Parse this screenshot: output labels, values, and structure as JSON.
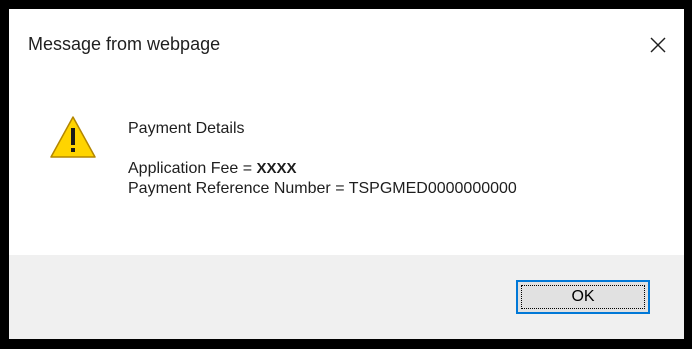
{
  "dialog": {
    "title": "Message from webpage",
    "close_icon": "close-icon",
    "warning_icon": "warning-icon",
    "message": {
      "heading": "Payment Details",
      "fee_label": "Application Fee = ",
      "fee_value": "XXXX",
      "reference_line": "Payment Reference Number = TSPGMED0000000000"
    },
    "ok_label": "OK"
  },
  "colors": {
    "frame": "#000000",
    "footer_background": "#f0f0f0",
    "button_focus_border": "#0078d7",
    "warning_yellow": "#ffd400"
  }
}
